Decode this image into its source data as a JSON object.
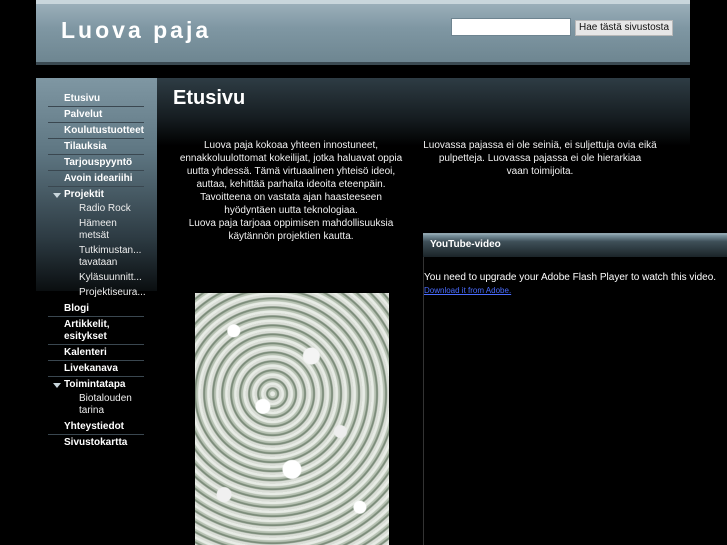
{
  "header": {
    "site_title": "Luova paja",
    "search_placeholder": "",
    "search_button": "Hae tästä sivustosta"
  },
  "nav": {
    "etusivu": "Etusivu",
    "palvelut": "Palvelut",
    "koulutustuotteet": "Koulutustuotteet",
    "tilauksia": "Tilauksia",
    "tarjouspyynto": "Tarjouspyyntö",
    "avoin_ideariihi": "Avoin ideariihi",
    "projektit": "Projektit",
    "radio_rock": "Radio Rock",
    "hameen_metsat": "Hämeen metsät",
    "tutkimustan": "Tutkimustan...",
    "tavataan": "tavataan",
    "kylasuunnitt": "Kyläsuunnitt...",
    "projektiseura": "Projektiseura...",
    "blogi": "Blogi",
    "artikkelit": "Artikkelit, esitykset",
    "kalenteri": "Kalenteri",
    "livekanava": "Livekanava",
    "toimintatapa": "Toimintatapa",
    "biotalouden_tarina": "Biotalouden tarina",
    "yhteystiedot": "Yhteystiedot",
    "sivustokartta": "Sivustokartta"
  },
  "main": {
    "page_title": "Etusivu",
    "intro_line1": "Luova paja kokoaa yhteen innostuneet,",
    "intro_line2": "ennakkoluulottomat kokeilijat, jotka haluavat oppia",
    "intro_line3": "uutta yhdessä. Tämä virtuaalinen yhteisö ideoi,",
    "intro_line4": "auttaa, kehittää parhaita ideoita eteenpäin.",
    "intro_line5": "Tavoitteena on vastata ajan haasteeseen",
    "intro_line6": "hyödyntäen uutta teknologiaa.",
    "intro_line7": "Luova paja tarjoaa oppimisen mahdollisuuksia",
    "intro_line8": "käytännön projektien kautta.",
    "side_line1": "Luovassa pajassa ei ole seiniä, ei suljettuja ovia eikä",
    "side_line2": "pulpetteja. Luovassa pajassa ei ole hierarkiaa",
    "side_line3": "vaan toimijoita."
  },
  "youtube": {
    "title": "YouTube-video",
    "message": "You need to upgrade your Adobe Flash Player to watch this video.",
    "link": "Download it from Adobe."
  }
}
